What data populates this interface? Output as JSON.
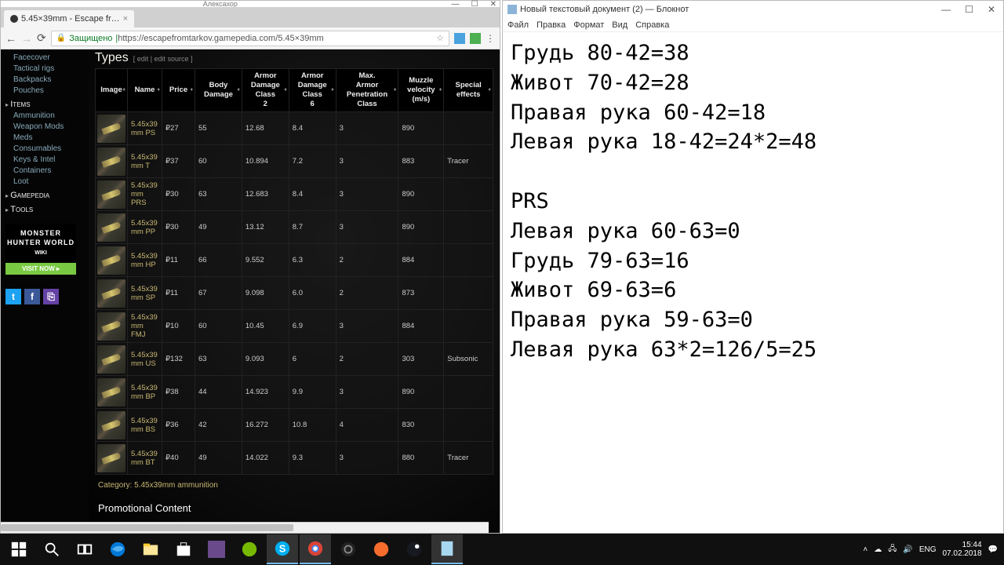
{
  "browser": {
    "tab_title": "5.45×39mm - Escape fr…",
    "titlebar_center": "Алексахоp",
    "nav": {
      "back": "←",
      "forward": "→",
      "reload": "⟳"
    },
    "secure_label": "Защищено",
    "url": "https://escapefromtarkov.gamepedia.com/5.45×39mm",
    "star": "☆"
  },
  "sidebar": {
    "group_a": [
      "Facecover",
      "Tactical rigs",
      "Backpacks",
      "Pouches"
    ],
    "section_items": "Items",
    "group_items": [
      "Ammunition",
      "Weapon Mods",
      "Meds",
      "Consumables",
      "Keys & Intel",
      "Containers",
      "Loot"
    ],
    "section_gamepedia": "Gamepedia",
    "section_tools": "Tools",
    "ad": {
      "title": "MONSTER HUNTER WORLD",
      "sub": "WIKI",
      "cta": "VISIT NOW ▸"
    },
    "social": {
      "tw": "t",
      "fb": "f",
      "tc": "⎘"
    }
  },
  "main": {
    "types_title": "Types",
    "types_edit": "[ edit | edit source ]",
    "headers": [
      "Image",
      "Name",
      "Price",
      "Body Damage",
      "Armor Damage Class 2",
      "Armor Damage Class 6",
      "Max. Armor Penetration Class",
      "Muzzle velocity (m/s)",
      "Special effects"
    ],
    "rows": [
      {
        "name": "5.45x39 mm PS",
        "price": "₽27",
        "body": "55",
        "c2": "12.68",
        "c6": "8.4",
        "pen": "3",
        "mv": "890",
        "sp": ""
      },
      {
        "name": "5.45x39 mm T",
        "price": "₽37",
        "body": "60",
        "c2": "10.894",
        "c6": "7.2",
        "pen": "3",
        "mv": "883",
        "sp": "Tracer"
      },
      {
        "name": "5.45x39 mm PRS",
        "price": "₽30",
        "body": "63",
        "c2": "12.683",
        "c6": "8.4",
        "pen": "3",
        "mv": "890",
        "sp": ""
      },
      {
        "name": "5.45x39 mm PP",
        "price": "₽30",
        "body": "49",
        "c2": "13.12",
        "c6": "8.7",
        "pen": "3",
        "mv": "890",
        "sp": ""
      },
      {
        "name": "5.45x39 mm HP",
        "price": "₽11",
        "body": "66",
        "c2": "9.552",
        "c6": "6.3",
        "pen": "2",
        "mv": "884",
        "sp": ""
      },
      {
        "name": "5.45x39 mm SP",
        "price": "₽11",
        "body": "67",
        "c2": "9.098",
        "c6": "6.0",
        "pen": "2",
        "mv": "873",
        "sp": ""
      },
      {
        "name": "5.45x39 mm FMJ",
        "price": "₽10",
        "body": "60",
        "c2": "10.45",
        "c6": "6.9",
        "pen": "3",
        "mv": "884",
        "sp": ""
      },
      {
        "name": "5.45x39 mm US",
        "price": "₽132",
        "body": "63",
        "c2": "9.093",
        "c6": "6",
        "pen": "2",
        "mv": "303",
        "sp": "Subsonic"
      },
      {
        "name": "5.45x39 mm BP",
        "price": "₽38",
        "body": "44",
        "c2": "14.923",
        "c6": "9.9",
        "pen": "3",
        "mv": "890",
        "sp": ""
      },
      {
        "name": "5.45x39 mm BS",
        "price": "₽36",
        "body": "42",
        "c2": "16.272",
        "c6": "10.8",
        "pen": "4",
        "mv": "830",
        "sp": ""
      },
      {
        "name": "5.45x39 mm BT",
        "price": "₽40",
        "body": "49",
        "c2": "14.022",
        "c6": "9.3",
        "pen": "3",
        "mv": "880",
        "sp": "Tracer"
      }
    ],
    "category": "Category:  5.45x39mm ammunition",
    "promo": "Promotional Content"
  },
  "notepad": {
    "title": "Новый текстовый документ (2) — Блокнот",
    "menu": [
      "Файл",
      "Правка",
      "Формат",
      "Вид",
      "Справка"
    ],
    "body": "Грудь 80-42=38\nЖивот 70-42=28\nПравая рука 60-42=18\nЛевая рука 18-42=24*2=48\n\nPRS\nЛевая рука 60-63=0\nГрудь 79-63=16\nЖивот 69-63=6\nПравая рука 59-63=0\nЛевая рука 63*2=126/5=25"
  },
  "taskbar": {
    "tray": {
      "lang": "ENG",
      "time": "15:44",
      "date": "07.02.2018"
    }
  }
}
